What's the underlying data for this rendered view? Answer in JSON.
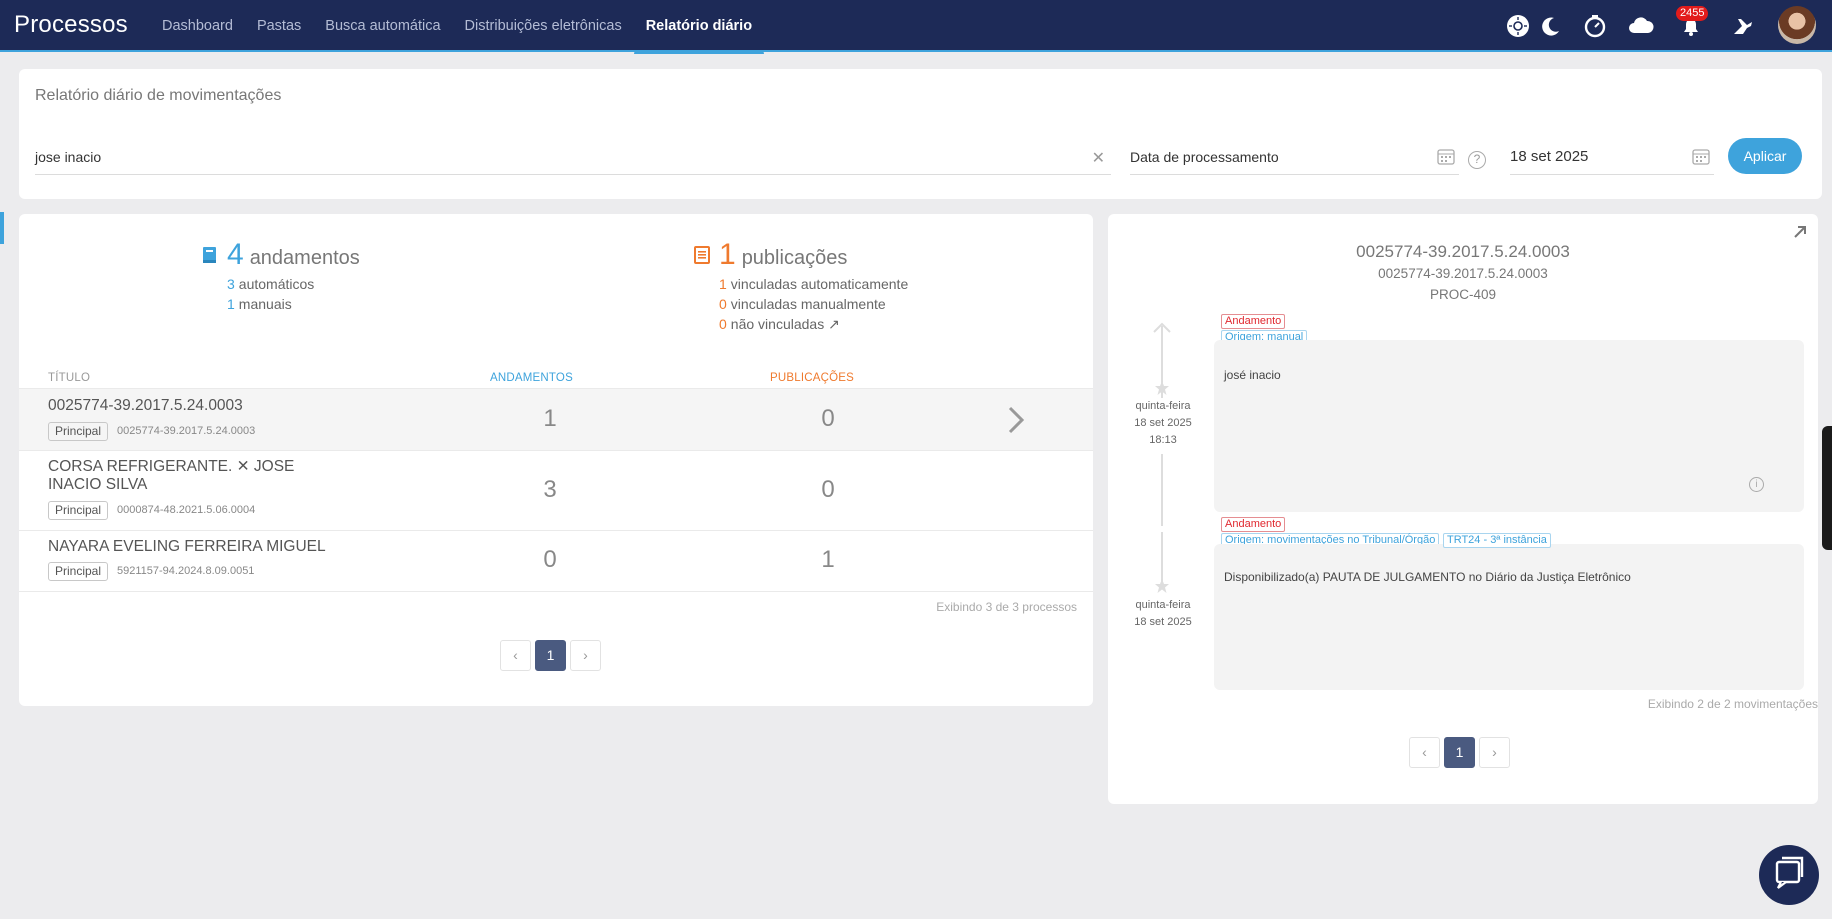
{
  "app": {
    "title": "Processos"
  },
  "nav": [
    "Dashboard",
    "Pastas",
    "Busca automática",
    "Distribuições eletrônicas",
    "Relatório diário"
  ],
  "header": {
    "notifications": "2455"
  },
  "filter": {
    "title": "Relatório diário de movimentações",
    "search_value": "jose inacio",
    "date_type": "Data de processamento",
    "date_value": "18 set 2025",
    "apply_label": "Aplicar"
  },
  "stats": {
    "andamentos": {
      "count": "4",
      "label": "andamentos",
      "lines": [
        {
          "n": "3",
          "label": "automáticos"
        },
        {
          "n": "1",
          "label": "manuais"
        }
      ]
    },
    "publicacoes": {
      "count": "1",
      "label": "publicações",
      "lines": [
        {
          "n": "1",
          "label": "vinculadas automaticamente"
        },
        {
          "n": "0",
          "label": "vinculadas manualmente"
        },
        {
          "n": "0",
          "label": "não vinculadas ↗"
        }
      ]
    }
  },
  "table": {
    "headers": {
      "title": "TÍTULO",
      "andamentos": "ANDAMENTOS",
      "publicacoes": "PUBLICAÇÕES"
    },
    "rows": [
      {
        "title": "0025774-39.2017.5.24.0003",
        "tag": "Principal",
        "number": "0025774-39.2017.5.24.0003",
        "andamentos": "1",
        "publicacoes": "0"
      },
      {
        "title": "CORSA REFRIGERANTE. ✕ JOSE INACIO SILVA",
        "tag": "Principal",
        "number": "0000874-48.2021.5.06.0004",
        "andamentos": "3",
        "publicacoes": "0"
      },
      {
        "title": "NAYARA EVELING FERREIRA MIGUEL",
        "tag": "Principal",
        "number": "5921157-94.2024.8.09.0051",
        "andamentos": "0",
        "publicacoes": "1"
      }
    ],
    "showing": "Exibindo 3 de 3 processos",
    "pager": {
      "prev": "‹",
      "current": "1",
      "next": "›"
    }
  },
  "detail": {
    "title": "0025774-39.2017.5.24.0003",
    "subtitle": "0025774-39.2017.5.24.0003",
    "code": "PROC-409",
    "movements": [
      {
        "weekday": "quinta-feira",
        "date": "18 set 2025",
        "time": "18:13",
        "type": "Andamento",
        "origin": "Origem: manual",
        "text": "josé inacio"
      },
      {
        "weekday": "quinta-feira",
        "date": "18 set 2025",
        "time": "",
        "type": "Andamento",
        "origin": "Origem: movimentações no Tribunal/Órgão",
        "court": "TRT24 - 3ª instância",
        "text": "Disponibilizado(a) PAUTA DE JULGAMENTO no Diário da Justiça Eletrônico"
      }
    ],
    "showing": "Exibindo 2 de 2 movimentações",
    "pager": {
      "prev": "‹",
      "current": "1",
      "next": "›"
    }
  },
  "colors": {
    "navbar": "#1d2a57",
    "accent": "#3ea3dc",
    "orange": "#ef7a2e",
    "badge": "#e21b1b",
    "pager_active": "#4a5a80"
  }
}
